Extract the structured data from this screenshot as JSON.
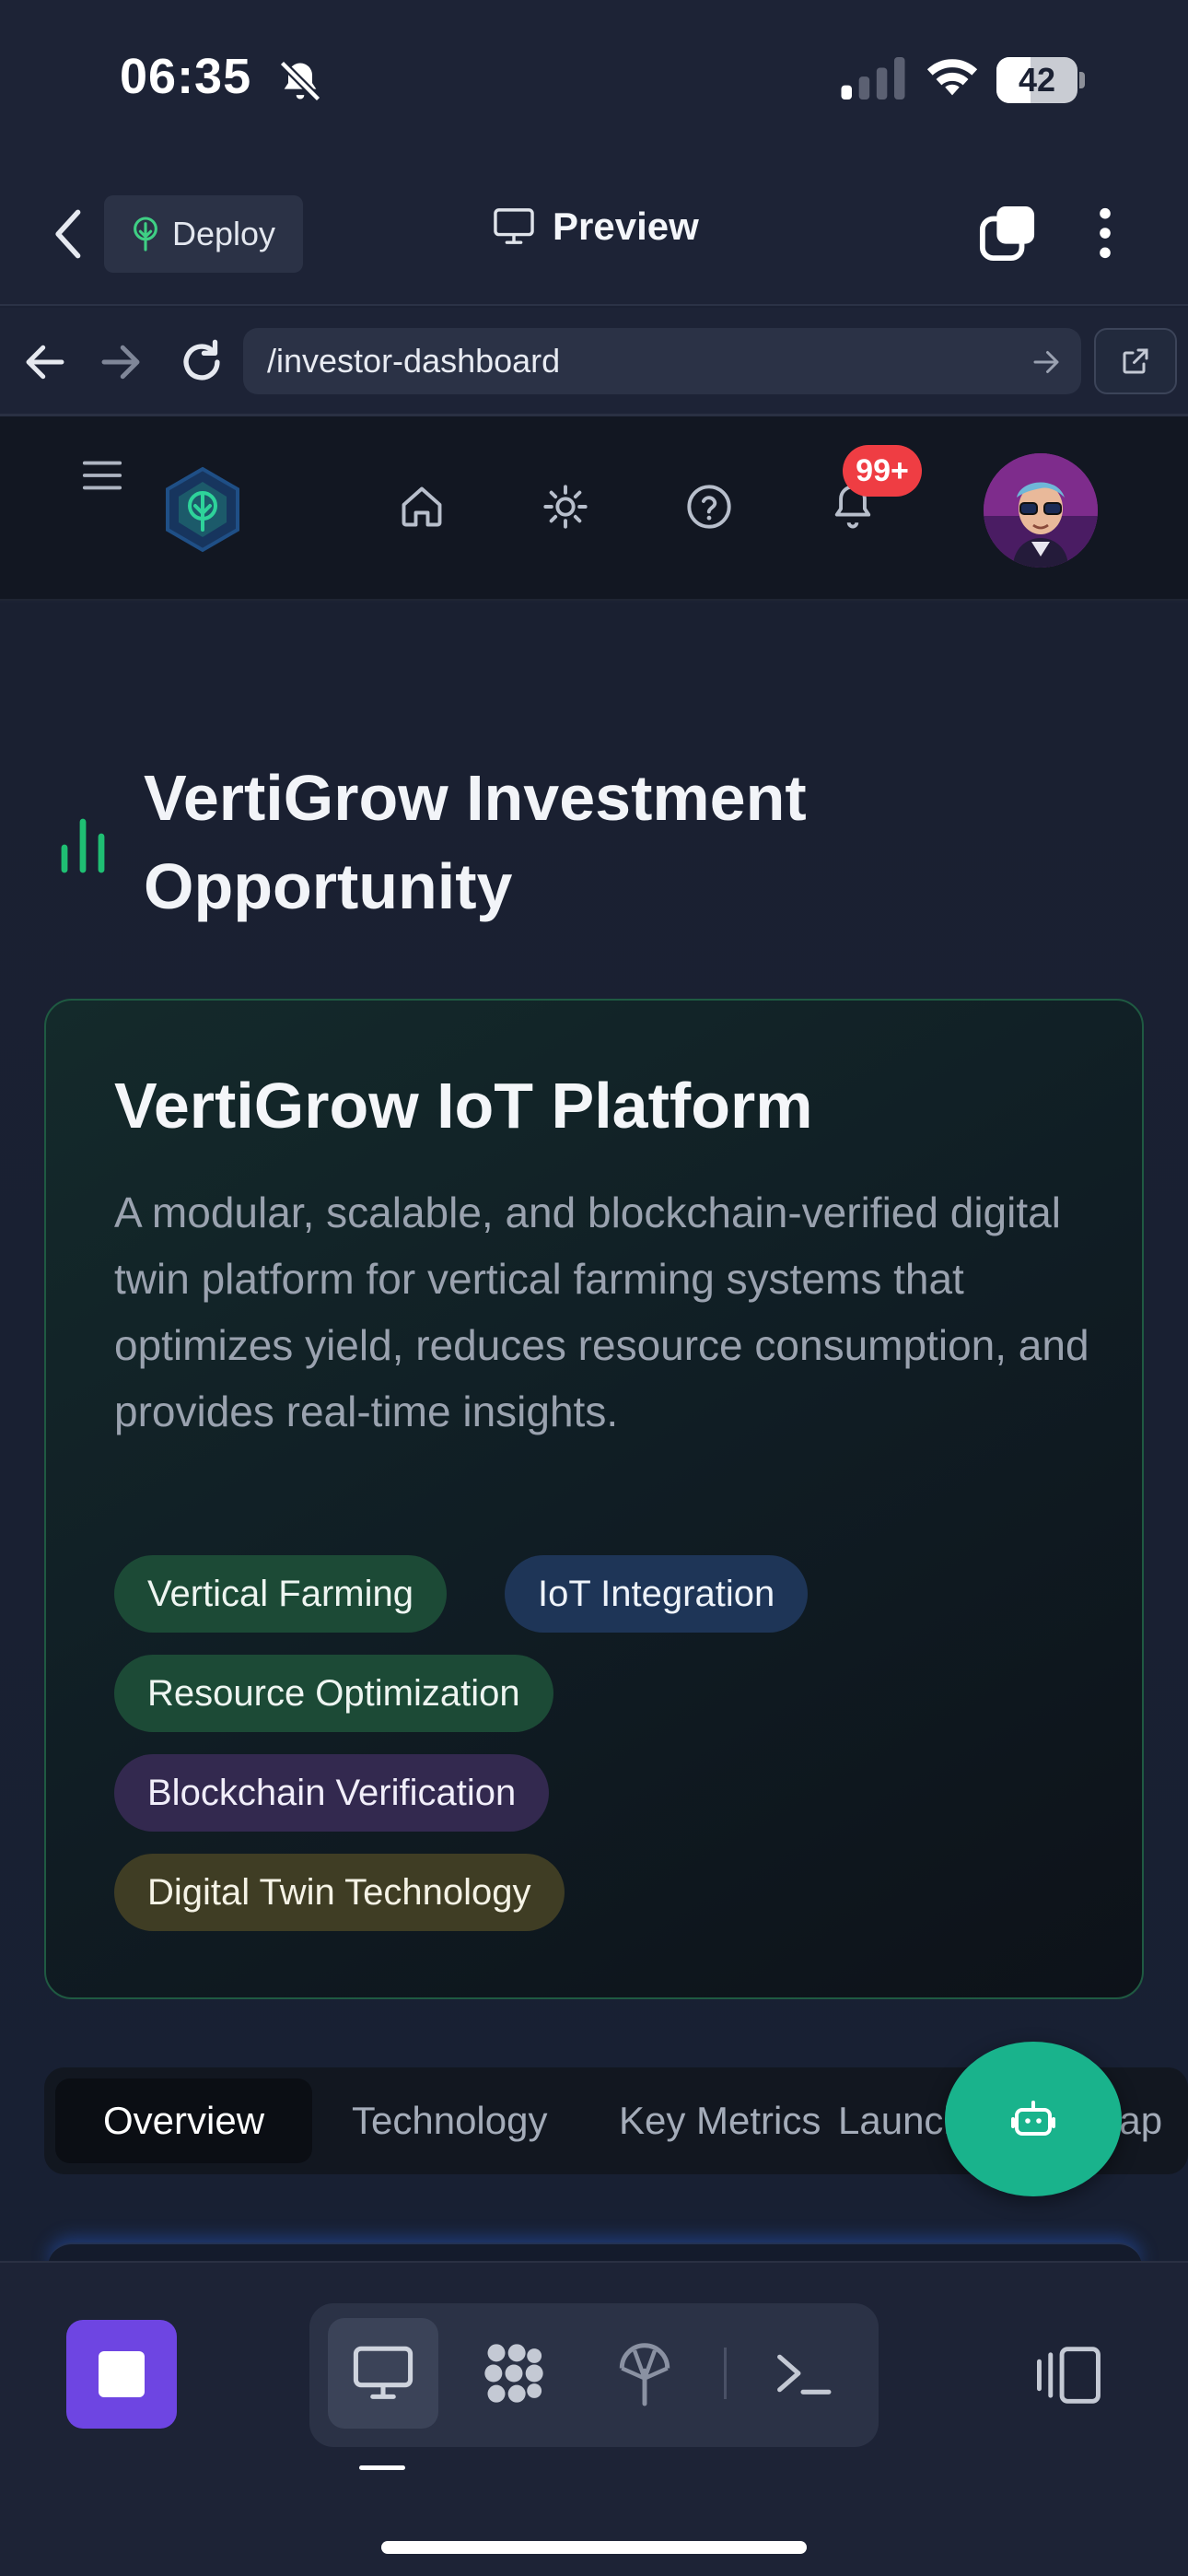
{
  "status_bar": {
    "time": "06:35",
    "battery": "42",
    "battery_level": 0.42
  },
  "app_header": {
    "deploy_label": "Deploy",
    "preview_label": "Preview"
  },
  "url_bar": {
    "url": "/investor-dashboard"
  },
  "site_nav": {
    "notification_count": "99+"
  },
  "page": {
    "title": "VertiGrow Investment Opportunity"
  },
  "card": {
    "title": "VertiGrow IoT Platform",
    "description": "A modular, scalable, and blockchain-verified digital twin platform for vertical farming systems that optimizes yield, reduces resource consumption, and provides real-time insights.",
    "tags": [
      {
        "label": "Vertical Farming",
        "color": "#1c4a36"
      },
      {
        "label": "IoT Integration",
        "color": "#1e3557"
      },
      {
        "label": "Resource Optimization",
        "color": "#1c4a36"
      },
      {
        "label": "Blockchain Verification",
        "color": "#33294f"
      },
      {
        "label": "Digital Twin Technology",
        "color": "#3f3d24"
      }
    ]
  },
  "tabs": [
    {
      "label": "Overview",
      "active": true
    },
    {
      "label": "Technology",
      "active": false
    },
    {
      "label": "Key Metrics",
      "active": false
    },
    {
      "label": "Launch",
      "active": false
    },
    {
      "label": "Roadmap",
      "active": false
    }
  ],
  "bottom_toolbar": {
    "tools": [
      "monitor-icon",
      "grid-dots-icon",
      "antenna-icon",
      "terminal-icon"
    ],
    "selected_tool": "monitor-icon"
  },
  "colors": {
    "accent_green": "#19b38c",
    "stop_purple": "#6e45e2",
    "badge_red": "#ef3d43",
    "page_bg": "#1b2133"
  }
}
